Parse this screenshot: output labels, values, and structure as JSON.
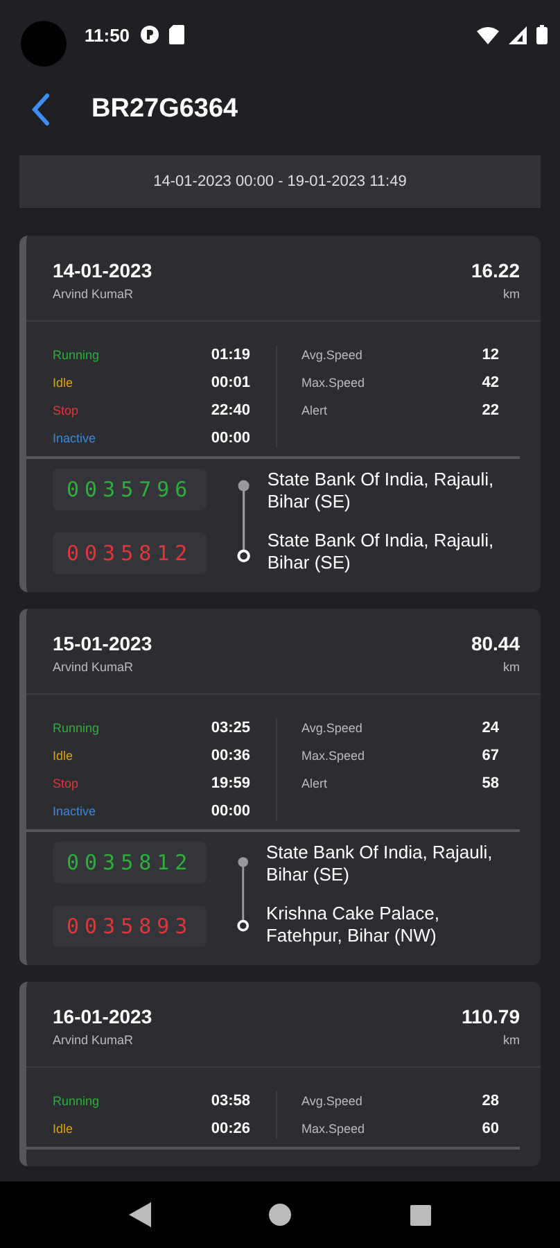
{
  "status_bar": {
    "time": "11:50"
  },
  "header": {
    "title": "BR27G6364"
  },
  "date_range": "14-01-2023 00:00 - 19-01-2023 11:49",
  "trips": [
    {
      "date": "14-01-2023",
      "driver": "Arvind KumaR",
      "distance": "16.22",
      "unit": "km",
      "states": [
        {
          "kind": "running",
          "label": "Running",
          "value": "01:19"
        },
        {
          "kind": "idle",
          "label": "Idle",
          "value": "00:01"
        },
        {
          "kind": "stop",
          "label": "Stop",
          "value": "22:40"
        },
        {
          "kind": "inactive",
          "label": "Inactive",
          "value": "00:00"
        }
      ],
      "stats": [
        {
          "label": "Avg.Speed",
          "value": "12"
        },
        {
          "label": "Max.Speed",
          "value": "42"
        },
        {
          "label": "Alert",
          "value": "22"
        }
      ],
      "odometer_start": "0035796",
      "odometer_end": "0035812",
      "start_location": "State Bank Of India, Rajauli, Bihar (SE)",
      "end_location": "State Bank Of India, Rajauli, Bihar (SE)"
    },
    {
      "date": "15-01-2023",
      "driver": "Arvind KumaR",
      "distance": "80.44",
      "unit": "km",
      "states": [
        {
          "kind": "running",
          "label": "Running",
          "value": "03:25"
        },
        {
          "kind": "idle",
          "label": "Idle",
          "value": "00:36"
        },
        {
          "kind": "stop",
          "label": "Stop",
          "value": "19:59"
        },
        {
          "kind": "inactive",
          "label": "Inactive",
          "value": "00:00"
        }
      ],
      "stats": [
        {
          "label": "Avg.Speed",
          "value": "24"
        },
        {
          "label": "Max.Speed",
          "value": "67"
        },
        {
          "label": "Alert",
          "value": "58"
        }
      ],
      "odometer_start": "0035812",
      "odometer_end": "0035893",
      "start_location": "State Bank Of India, Rajauli, Bihar (SE)",
      "end_location": "Krishna Cake Palace, Fatehpur, Bihar (NW)"
    },
    {
      "date": "16-01-2023",
      "driver": "Arvind KumaR",
      "distance": "110.79",
      "unit": "km",
      "states": [
        {
          "kind": "running",
          "label": "Running",
          "value": "03:58"
        },
        {
          "kind": "idle",
          "label": "Idle",
          "value": "00:26"
        }
      ],
      "stats": [
        {
          "label": "Avg.Speed",
          "value": "28"
        },
        {
          "label": "Max.Speed",
          "value": "60"
        }
      ]
    }
  ]
}
